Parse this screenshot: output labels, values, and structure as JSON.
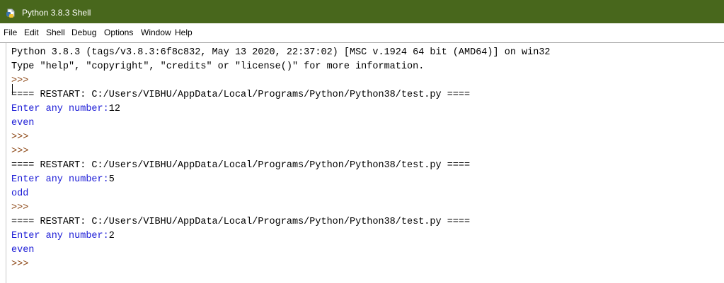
{
  "window": {
    "title": "Python 3.8.3 Shell",
    "title_bar_color": "#48671c",
    "icon": "python-idle-icon"
  },
  "menu": [
    {
      "label": "File"
    },
    {
      "label": "Edit"
    },
    {
      "label": "Shell"
    },
    {
      "label": "Debug"
    },
    {
      "label": "Options"
    },
    {
      "label": "Window"
    },
    {
      "label": "Help"
    }
  ],
  "colors": {
    "stdout": "#1a1ad6",
    "prompt": "#8b4513",
    "output": "#000000"
  },
  "shell": {
    "banner_line1": "Python 3.8.3 (tags/v3.8.3:6f8c832, May 13 2020, 22:37:02) [MSC v.1924 64 bit (AMD64)] on win32",
    "banner_line2": "Type \"help\", \"copyright\", \"credits\" or \"license()\" for more information.",
    "prompt": ">>>",
    "restart_line": "==== RESTART: C:/Users/VIBHU/AppData/Local/Programs/Python/Python38/test.py ====",
    "input_prompt": "Enter any number:",
    "runs": [
      {
        "input": "12",
        "result": "even"
      },
      {
        "input": "5",
        "result": "odd"
      },
      {
        "input": "2",
        "result": "even"
      }
    ]
  }
}
